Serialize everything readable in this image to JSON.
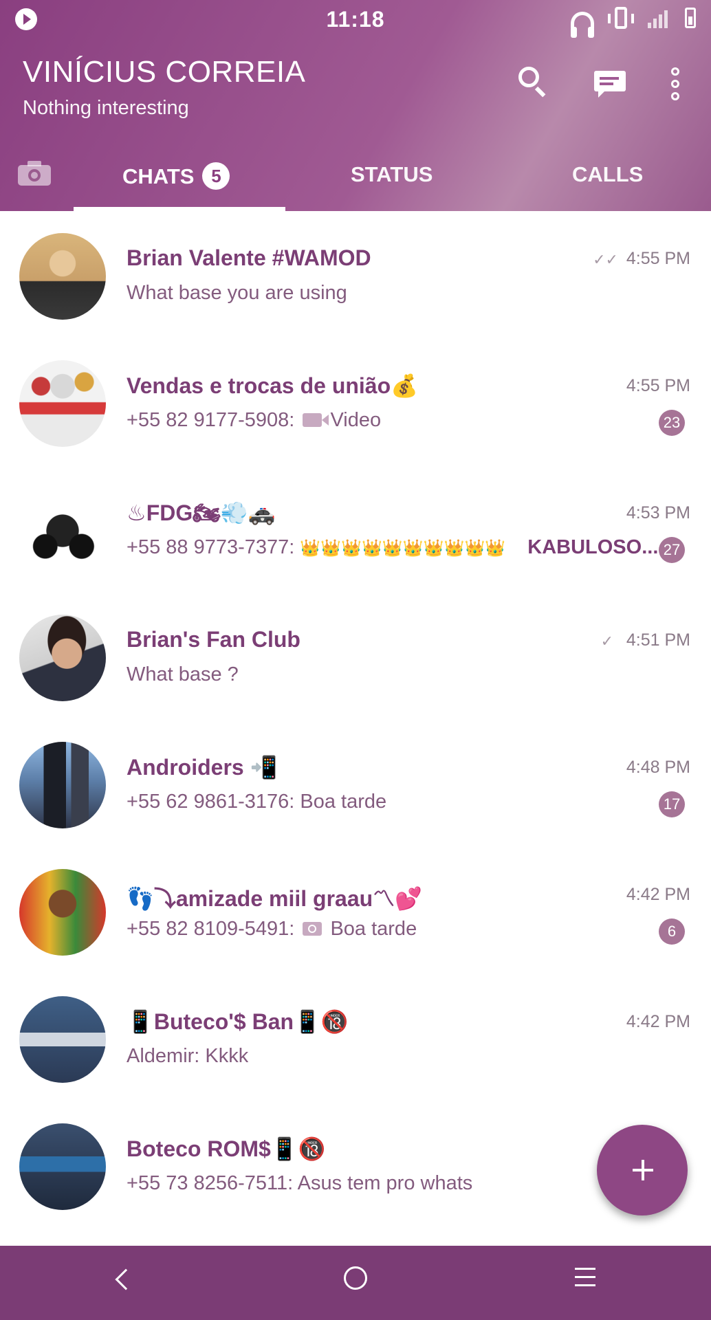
{
  "statusbar": {
    "time": "11:18"
  },
  "header": {
    "title": "VINÍCIUS CORREIA",
    "subtitle": "Nothing interesting",
    "icons": [
      "search-icon",
      "new-chat-icon",
      "more-vert-icon"
    ]
  },
  "tabs": {
    "chats": "CHATS",
    "chats_badge": "5",
    "status": "STATUS",
    "calls": "CALLS"
  },
  "chats": [
    {
      "name": "Brian Valente #WAMOD",
      "preview": "What base you are using",
      "time": "4:55 PM",
      "ticks": "✓✓",
      "unread": ""
    },
    {
      "name": "Vendas e trocas de união💰",
      "sender": "+55 82 9177-5908:",
      "preview": "Video",
      "media": "video",
      "time": "4:55 PM",
      "unread": "23"
    },
    {
      "name": "♨FDG🏍💨🚓",
      "sender": "+55 88 9773-7377:",
      "preview": "👑👑👑👑👑👑👑👑👑👑",
      "extra": "KABULOSO...",
      "time": "4:53 PM",
      "unread": "27"
    },
    {
      "name": "Brian's Fan Club",
      "preview": "What base ?",
      "time": "4:51 PM",
      "ticks": "✓",
      "unread": ""
    },
    {
      "name": "Androiders 📲",
      "sender": "+55 62 9861-3176:",
      "preview": "Boa tarde",
      "time": "4:48 PM",
      "unread": "17"
    },
    {
      "name": "👣⤵amizade miil graau〽💕",
      "sender": "+55 82 8109-5491:",
      "preview": "Boa tarde",
      "media": "camera",
      "time": "4:42 PM",
      "unread": "6"
    },
    {
      "name": "📱Buteco'$ Ban📱🔞",
      "sender": "Aldemir:",
      "preview": "Kkkk",
      "time": "4:42 PM",
      "unread": ""
    },
    {
      "name": "Boteco ROM$📱🔞",
      "sender": "+55 73 8256-7511:",
      "preview": "Asus tem pro whats",
      "time": "",
      "unread": ""
    }
  ],
  "colors": {
    "primary": "#8a3f80",
    "accent": "#8e4784",
    "chat_name": "#7b3e75",
    "unread_badge": "#a67496"
  }
}
